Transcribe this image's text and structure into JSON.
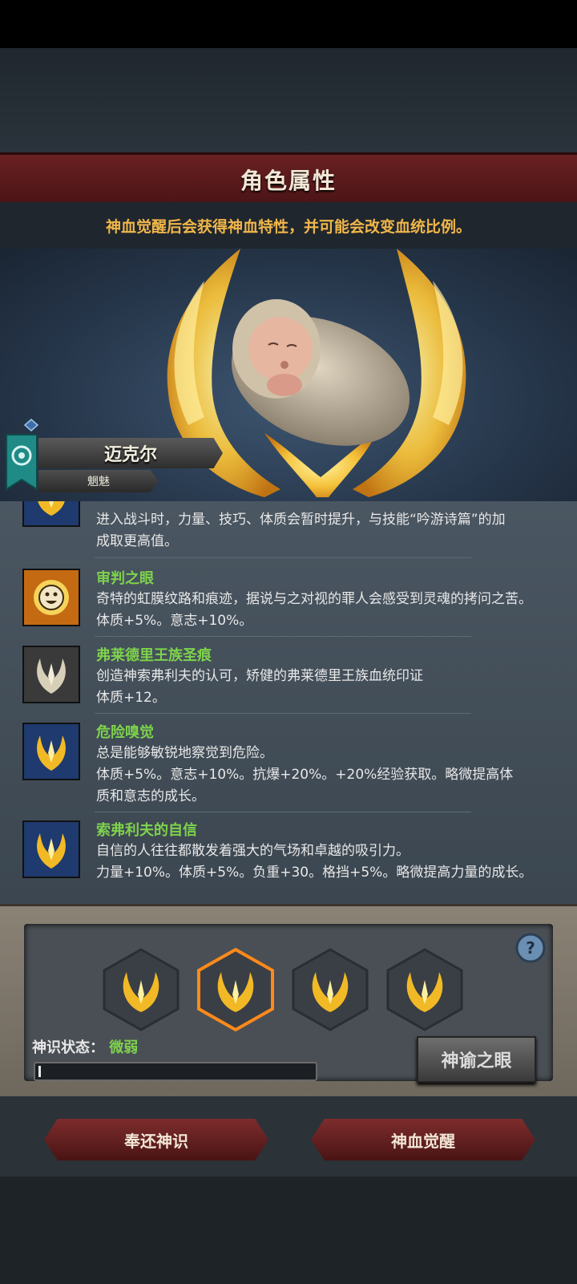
{
  "header": {
    "title": "角色属性",
    "subtitle": "神血觉醒后会获得神血特性，并可能会改变血统比例。"
  },
  "character": {
    "name": "迈克尔",
    "trait": "魍魅"
  },
  "traits": [
    {
      "name": "",
      "icon": "divine-crest-icon",
      "lines": [
        "进入战斗时，力量、技巧、体质会暂时提升，与技能“吟游诗篇”的加",
        "成取更高值。"
      ]
    },
    {
      "name": "审判之眼",
      "icon": "smiling-sun-icon",
      "lines": [
        "奇特的虹膜纹路和痕迹，据说与之对视的罪人会感受到灵魂的拷问之苦。",
        "体质+5%。意志+10%。"
      ]
    },
    {
      "name": "弗莱德里王族圣痕",
      "icon": "stigmata-icon",
      "lines": [
        "创造神索弗利夫的认可，矫健的弗莱德里王族血统印证",
        "体质+12。"
      ]
    },
    {
      "name": "危险嗅觉",
      "icon": "divine-crest-icon",
      "lines": [
        "总是能够敏锐地察觉到危险。",
        "体质+5%。意志+10%。抗爆+20%。+20%经验获取。略微提高体",
        "质和意志的成长。"
      ]
    },
    {
      "name": "索弗利夫的自信",
      "icon": "divine-crest-icon",
      "lines": [
        "自信的人往往都散发着强大的气场和卓越的吸引力。",
        "力量+10%。体质+5%。负重+30。格挡+5%。略微提高力量的成长。"
      ]
    }
  ],
  "panel": {
    "status_label": "神识状态：",
    "status_value": "微弱",
    "oracle_button": "神谕之眼",
    "help_icon": "?",
    "progress_fraction": 0.01
  },
  "footer": {
    "return_button": "奉还神识",
    "awaken_button": "神血觉醒"
  },
  "colors": {
    "accent_gold": "#f0b64a",
    "trait_green": "#7ed24c",
    "banner_red": "#6a2022"
  }
}
